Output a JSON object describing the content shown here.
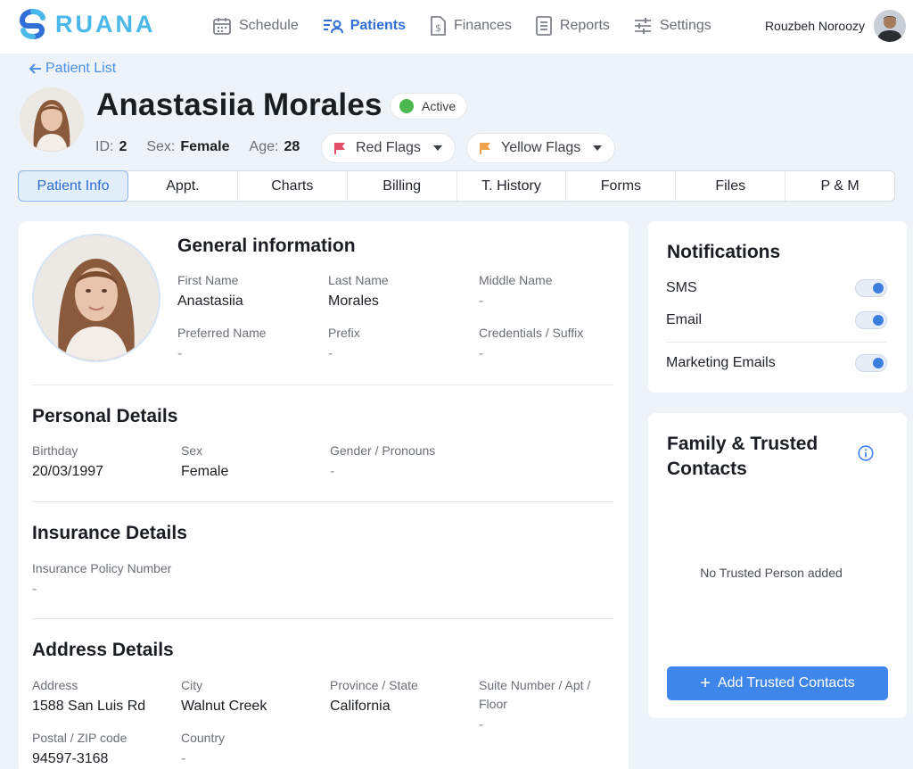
{
  "app": {
    "brand": "RUANA"
  },
  "nav": {
    "items": [
      {
        "label": "Schedule",
        "icon": "calendar-icon"
      },
      {
        "label": "Patients",
        "icon": "patients-icon",
        "active": true
      },
      {
        "label": "Finances",
        "icon": "finance-icon"
      },
      {
        "label": "Reports",
        "icon": "reports-icon"
      },
      {
        "label": "Settings",
        "icon": "settings-sliders-icon"
      }
    ]
  },
  "user": {
    "name": "Rouzbeh Noroozy"
  },
  "header": {
    "back_label": "Patient List",
    "patient_name": "Anastasiia Morales",
    "status": "Active",
    "status_color": "#4bb850",
    "id_label": "ID:",
    "id_value": "2",
    "sex_label": "Sex:",
    "sex_value": "Female",
    "age_label": "Age:",
    "age_value": "28",
    "red_flags_label": "Red Flags",
    "red_flag_color": "#e2506a",
    "yellow_flags_label": "Yellow Flags",
    "yellow_flag_color": "#f0a24a"
  },
  "tabs": [
    "Patient Info",
    "Appt.",
    "Charts",
    "Billing",
    "T. History",
    "Forms",
    "Files",
    "P & M"
  ],
  "active_tab": "Patient Info",
  "general": {
    "title": "General information",
    "first_name_label": "First Name",
    "first_name": "Anastasiia",
    "last_name_label": "Last Name",
    "last_name": "Morales",
    "middle_name_label": "Middle Name",
    "middle_name": "-",
    "preferred_name_label": "Preferred Name",
    "preferred_name": "-",
    "prefix_label": "Prefix",
    "prefix": "-",
    "credentials_label": "Credentials / Suffix",
    "credentials": "-"
  },
  "personal": {
    "title": "Personal Details",
    "birthday_label": "Birthday",
    "birthday": "20/03/1997",
    "sex_label": "Sex",
    "sex": "Female",
    "gender_label": "Gender / Pronouns",
    "gender": "-"
  },
  "insurance": {
    "title": "Insurance Details",
    "policy_label": "Insurance Policy Number",
    "policy": "-"
  },
  "address": {
    "title": "Address Details",
    "address_label": "Address",
    "address": "1588 San Luis Rd",
    "city_label": "City",
    "city": "Walnut Creek",
    "province_label": "Province / State",
    "province": "California",
    "suite_label_1": "Suite Number / Apt /",
    "suite_label_2": "Floor",
    "suite": "-",
    "postal_label": "Postal / ZIP code",
    "postal": "94597-3168",
    "country_label": "Country",
    "country": "-"
  },
  "notifications": {
    "title": "Notifications",
    "items": [
      {
        "label": "SMS",
        "enabled": true
      },
      {
        "label": "Email",
        "enabled": true
      },
      {
        "label": "Marketing Emails",
        "enabled": true
      }
    ]
  },
  "family": {
    "title": "Family & Trusted Contacts",
    "empty_text": "No Trusted Person added",
    "add_label": "Add Trusted Contacts"
  },
  "colors": {
    "accent": "#2f6fd6",
    "button": "#3f86ea",
    "brand": "#4ab8e8"
  }
}
